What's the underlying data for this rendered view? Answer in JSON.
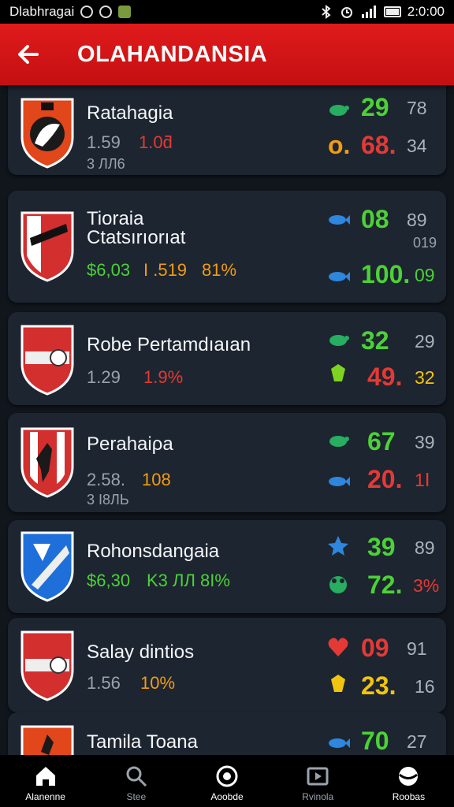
{
  "status_bar": {
    "carrier": "Dlabhragai",
    "time": "2:0:00"
  },
  "header": {
    "title": "OLAHANDANSIA"
  },
  "icons": {
    "back": "arrow-left-icon"
  },
  "colors": {
    "app_bar": "#d7161a",
    "card": "#1d2530",
    "background": "#11161d",
    "green": "#4cd137",
    "red": "#e53935",
    "orange": "#f39c12",
    "yellow": "#f1c40f"
  },
  "teams": [
    {
      "name": "Ratahagia",
      "stat1": "1.59",
      "stat2": "1.0ƌ",
      "stat3": "3 ЛЛ6",
      "score_top": "29",
      "side_top": "78",
      "score_bottom": "68.",
      "score_bottom_prefix": "o.",
      "side_bottom": "34"
    },
    {
      "name_line1": "Tioraia",
      "name_line2": "Ctatsırıorıat",
      "stat1": "$6,03",
      "stat2": "I .519",
      "stat3": "81%",
      "score_top": "08",
      "side_top": "89",
      "side_mid": "019",
      "score_bottom": "100.",
      "side_bottom": "09"
    },
    {
      "name": "Robe Pertamdıaıan",
      "stat1": "1.29",
      "stat2": "1.9%",
      "score_top": "32",
      "side_top": "29",
      "score_bottom": "49.",
      "side_bottom": "32"
    },
    {
      "name": "Perahaiρa",
      "stat1": "2.58.",
      "stat2": "108",
      "stat3": "3 І8ЛЬ",
      "score_top": "67",
      "side_top": "39",
      "score_bottom": "20.",
      "side_bottom": "1Ⅰ"
    },
    {
      "name": "Rohonsdangaia",
      "stat1": "$6,30",
      "stat2": "K3 ЛЛ",
      "stat3": "8I%",
      "score_top": "39",
      "side_top": "89",
      "score_bottom": "72.",
      "side_bottom": "3%"
    },
    {
      "name": "Salay dintios",
      "stat1": "1.56",
      "stat2": "10%",
      "score_top": "09",
      "side_top": "91",
      "score_bottom": "23.",
      "side_bottom": "16"
    },
    {
      "name": "Tamila Toana",
      "score_top": "70",
      "side_top": "27"
    }
  ],
  "nav": [
    {
      "label": "Alanenne",
      "icon": "home-icon"
    },
    {
      "label": "Stee",
      "icon": "search-icon"
    },
    {
      "label": "Aoobde",
      "icon": "shield-icon"
    },
    {
      "label": "Rvinola",
      "icon": "video-icon"
    },
    {
      "label": "Roobas",
      "icon": "ball-icon"
    }
  ]
}
